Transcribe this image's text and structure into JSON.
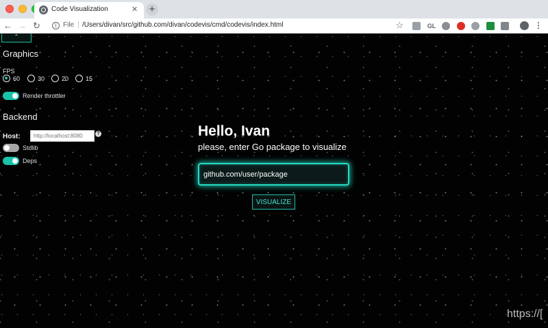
{
  "browser": {
    "tab_title": "Code Visualization",
    "tab_close": "✕",
    "new_tab": "+",
    "address_scheme": "File",
    "address_url": "/Users/divan/src/github.com/divan/codevis/cmd/codevis/index.html",
    "extensions": [
      "GL"
    ]
  },
  "sidebar": {
    "collapse_label": "⌃",
    "graphics_title": "Graphics",
    "fps_label": "FPS",
    "fps_options": [
      "60",
      "30",
      "20",
      "15"
    ],
    "fps_selected": "60",
    "render_throttler_label": "Render throttler",
    "render_throttler_on": true,
    "backend_title": "Backend",
    "host_label": "Host:",
    "host_placeholder": "http://localhost:8080",
    "help_icon": "?",
    "stdlib_label": "Stdlib",
    "stdlib_on": false,
    "deps_label": "Deps",
    "deps_on": true
  },
  "main": {
    "greeting": "Hello, Ivan",
    "subtitle": "please, enter Go package to visualize",
    "package_value": "github.com/user/package",
    "visualize_label": "VISUALIZE"
  },
  "watermark": "https://[",
  "colors": {
    "accent": "#23ddc4",
    "background": "#000000"
  }
}
